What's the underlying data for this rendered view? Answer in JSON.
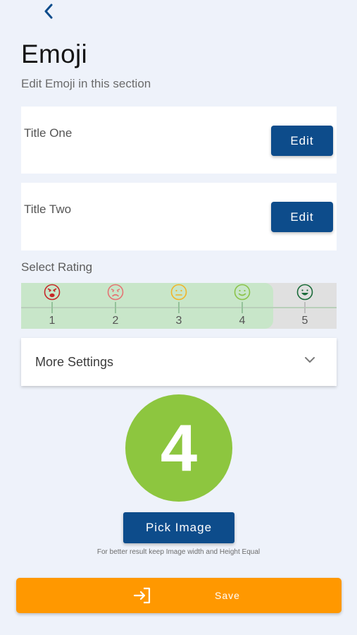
{
  "header": {
    "back_icon": "chevron-left-icon",
    "title": "Emoji",
    "subtitle": "Edit Emoji in this section"
  },
  "cards": [
    {
      "title": "Title One",
      "button": "Edit"
    },
    {
      "title": "Title Two",
      "button": "Edit"
    }
  ],
  "rating": {
    "label": "Select Rating",
    "selected": 4,
    "options": [
      {
        "value": "1",
        "icon": "angry-face-icon",
        "color": "#c62828"
      },
      {
        "value": "2",
        "icon": "sad-face-icon",
        "color": "#e57373"
      },
      {
        "value": "3",
        "icon": "neutral-face-icon",
        "color": "#f0b429"
      },
      {
        "value": "4",
        "icon": "smile-face-icon",
        "color": "#8bc34a"
      },
      {
        "value": "5",
        "icon": "happy-face-icon",
        "color": "#1b6b3a"
      }
    ]
  },
  "more_settings": {
    "label": "More Settings",
    "icon": "chevron-down-icon"
  },
  "preview": {
    "value": "4",
    "color": "#8dc63f"
  },
  "pick_image": {
    "label": "Pick Image",
    "hint": "For better result keep Image width and Height Equal"
  },
  "save": {
    "label": "Save",
    "icon": "login-arrow-icon",
    "color": "#ff9800"
  },
  "colors": {
    "primary": "#0d4c8b",
    "background": "#eef2fa"
  }
}
